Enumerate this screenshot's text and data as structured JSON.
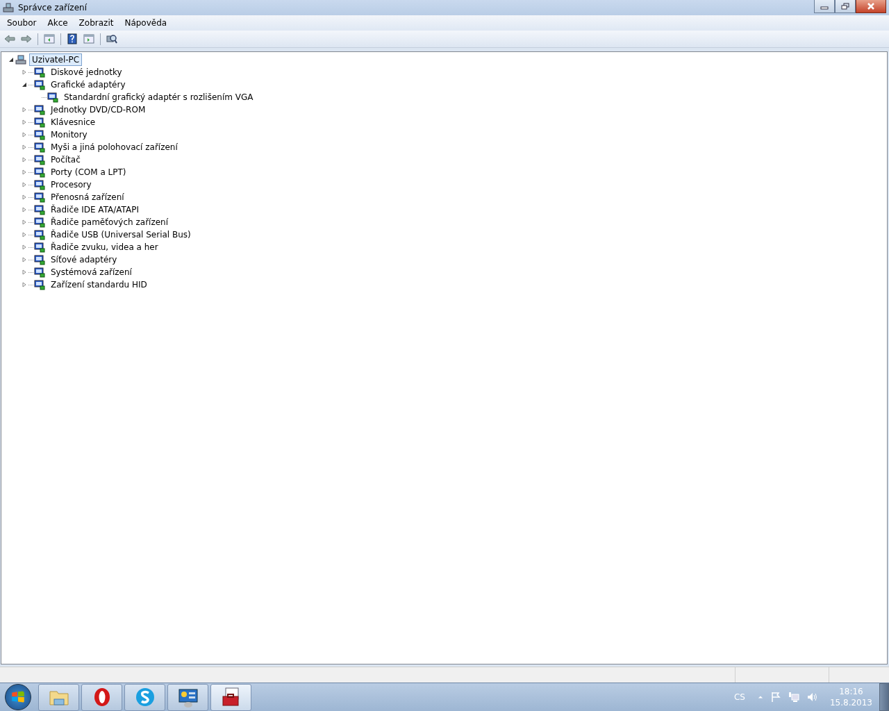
{
  "window": {
    "title": "Správce zařízení"
  },
  "menu": [
    "Soubor",
    "Akce",
    "Zobrazit",
    "Nápověda"
  ],
  "tree": {
    "label": "Uzivatel-PC",
    "expanded": true,
    "selected": true,
    "children": [
      {
        "label": "Diskové jednotky",
        "expanded": false,
        "selected": false
      },
      {
        "label": "Grafické adaptéry",
        "expanded": true,
        "selected": false,
        "children": [
          {
            "label": "Standardní grafický adaptér s rozlišením VGA",
            "selected": false
          }
        ]
      },
      {
        "label": "Jednotky DVD/CD-ROM",
        "expanded": false,
        "selected": false
      },
      {
        "label": "Klávesnice",
        "expanded": false,
        "selected": false
      },
      {
        "label": "Monitory",
        "expanded": false,
        "selected": false
      },
      {
        "label": "Myši a jiná polohovací zařízení",
        "expanded": false,
        "selected": false
      },
      {
        "label": "Počítač",
        "expanded": false,
        "selected": false
      },
      {
        "label": "Porty (COM a LPT)",
        "expanded": false,
        "selected": false
      },
      {
        "label": "Procesory",
        "expanded": false,
        "selected": false
      },
      {
        "label": "Přenosná zařízení",
        "expanded": false,
        "selected": false
      },
      {
        "label": "Řadiče IDE ATA/ATAPI",
        "expanded": false,
        "selected": false
      },
      {
        "label": "Řadiče paměťových zařízení",
        "expanded": false,
        "selected": false
      },
      {
        "label": "Řadiče USB (Universal Serial Bus)",
        "expanded": false,
        "selected": false
      },
      {
        "label": "Řadiče zvuku, videa a her",
        "expanded": false,
        "selected": false
      },
      {
        "label": "Síťové adaptéry",
        "expanded": false,
        "selected": false
      },
      {
        "label": "Systémová zařízení",
        "expanded": false,
        "selected": false
      },
      {
        "label": "Zařízení standardu HID",
        "expanded": false,
        "selected": false
      }
    ]
  },
  "taskbar": {
    "language": "CS",
    "time": "18:16",
    "date": "15.8.2013"
  }
}
